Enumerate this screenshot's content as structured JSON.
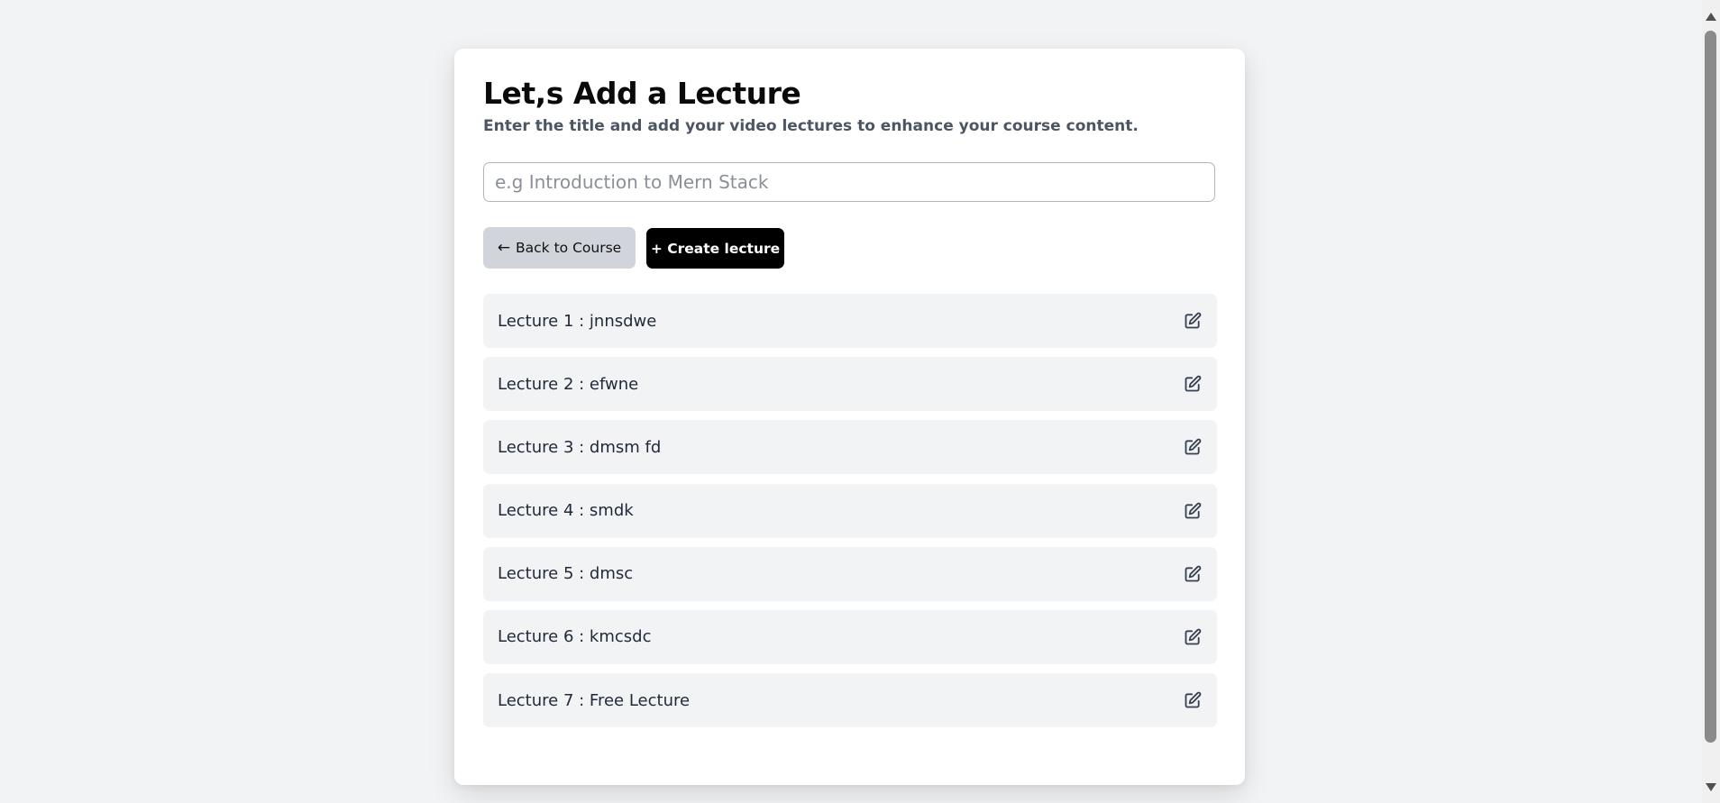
{
  "page": {
    "title": "Let,s Add a Lecture",
    "subtitle": "Enter the title and add your video lectures to enhance your course content."
  },
  "form": {
    "title_placeholder": "e.g Introduction to Mern Stack",
    "title_value": ""
  },
  "buttons": {
    "back_icon": "←",
    "back_label": "Back to Course",
    "create_label": "+ Create lecture"
  },
  "lectures": [
    {
      "label": "Lecture 1 : jnnsdwe",
      "icon": "edit-icon"
    },
    {
      "label": "Lecture 2 : efwne",
      "icon": "edit-icon"
    },
    {
      "label": "Lecture 3 : dmsm fd",
      "icon": "edit-icon"
    },
    {
      "label": "Lecture 4 : smdk",
      "icon": "edit-icon"
    },
    {
      "label": "Lecture 5 : dmsc",
      "icon": "edit-icon"
    },
    {
      "label": "Lecture 6 : kmcsdc",
      "icon": "edit-icon"
    },
    {
      "label": "Lecture 7 : Free Lecture",
      "icon": "edit-icon"
    }
  ],
  "colors": {
    "page_bg": "#f2f3f5",
    "card_bg": "#ffffff",
    "back_button_bg": "#d1d5db",
    "create_button_bg": "#000000",
    "lecture_item_bg": "#f2f3f5",
    "text_primary": "#0a0a0a",
    "text_secondary": "#4b5563"
  }
}
